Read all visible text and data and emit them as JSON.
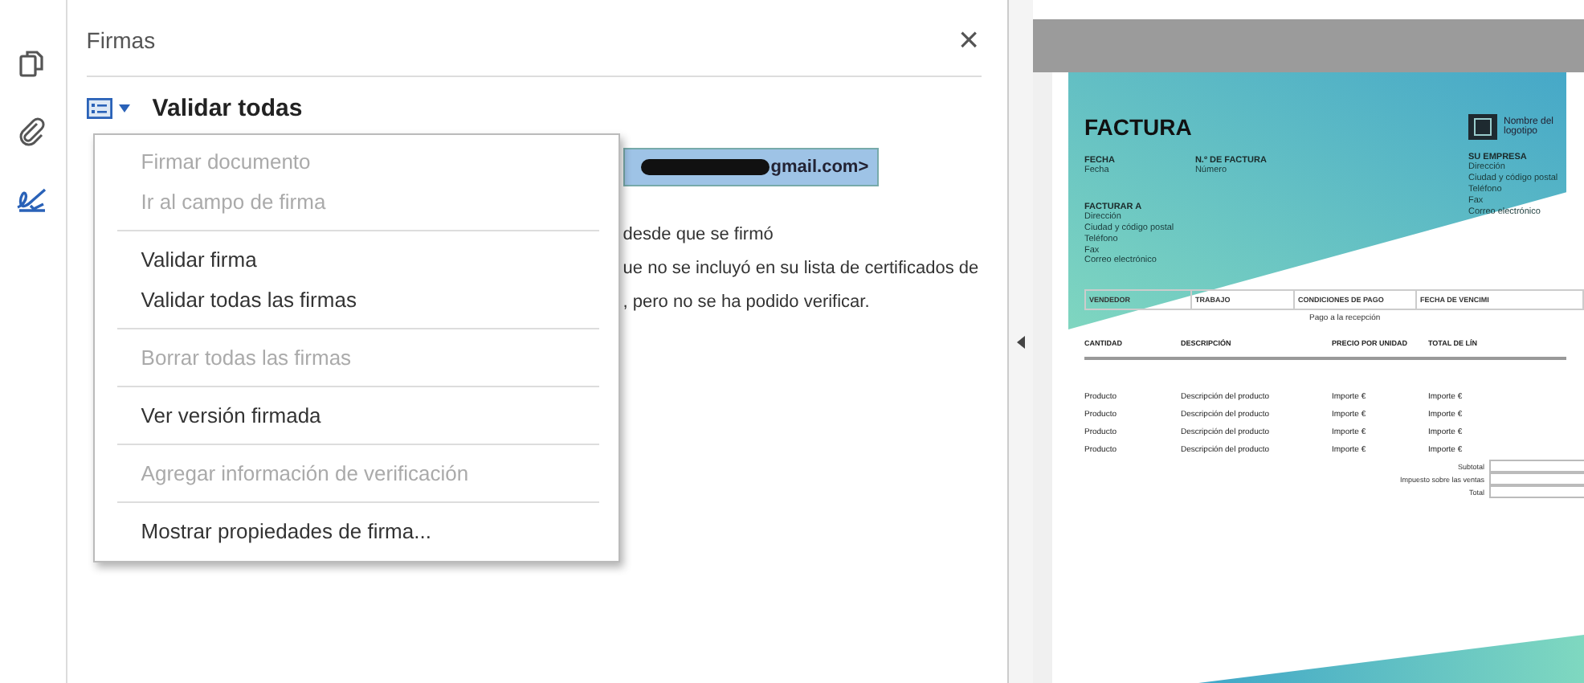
{
  "rail": [
    {
      "kind": "pages",
      "selected": false
    },
    {
      "kind": "attachments",
      "selected": false
    },
    {
      "kind": "signatures",
      "selected": true
    }
  ],
  "panel": {
    "title": "Firmas",
    "close": "×",
    "toolbar_label": "Validar todas",
    "signature_email": "gmail.com>",
    "details": [
      "desde que se firmó",
      "ue no se incluyó en su lista de certificados de",
      ", pero no se ha podido verificar."
    ]
  },
  "menu": [
    {
      "label": "Firmar documento",
      "disabled": true,
      "separator_before": false
    },
    {
      "label": "Ir al campo de firma",
      "disabled": true,
      "separator_before": false
    },
    {
      "label": "Validar firma",
      "disabled": false,
      "separator_before": true
    },
    {
      "label": "Validar todas las firmas",
      "disabled": false,
      "separator_before": false
    },
    {
      "label": "Borrar todas las firmas",
      "disabled": true,
      "separator_before": true
    },
    {
      "label": "Ver versión firmada",
      "disabled": false,
      "separator_before": true
    },
    {
      "label": "Agregar información de verificación",
      "disabled": true,
      "separator_before": true
    },
    {
      "label": "Mostrar propiedades de firma...",
      "disabled": false,
      "separator_before": true
    }
  ],
  "document": {
    "title": "FACTURA",
    "logo_text": "Nombre del logotipo",
    "date_label": "FECHA",
    "date_value": "Fecha",
    "number_label": "N.º DE FACTURA",
    "number_value": "Número",
    "company": {
      "heading": "SU EMPRESA",
      "lines": [
        "Dirección",
        "Ciudad y código postal",
        "Teléfono",
        "Fax",
        "Correo electrónico"
      ]
    },
    "bill_to": {
      "heading": "FACTURAR A",
      "lines": [
        "Dirección",
        "Ciudad y código postal",
        "Teléfono",
        "Fax",
        "Correo electrónico"
      ]
    },
    "terms_columns": [
      "VENDEDOR",
      "TRABAJO",
      "CONDICIONES DE PAGO",
      "FECHA DE VENCIMI"
    ],
    "terms_value": "Pago a la recepción",
    "item_columns": [
      "CANTIDAD",
      "DESCRIPCIÓN",
      "PRECIO POR UNIDAD",
      "TOTAL DE LÍN"
    ],
    "items": [
      {
        "quantity": "Producto",
        "description": "Descripción del producto",
        "unit_price": "Importe €",
        "total": "Importe €"
      },
      {
        "quantity": "Producto",
        "description": "Descripción del producto",
        "unit_price": "Importe €",
        "total": "Importe €"
      },
      {
        "quantity": "Producto",
        "description": "Descripción del producto",
        "unit_price": "Importe €",
        "total": "Importe €"
      },
      {
        "quantity": "Producto",
        "description": "Descripción del producto",
        "unit_price": "Importe €",
        "total": "Importe €"
      }
    ],
    "totals": [
      "Subtotal",
      "Impuesto sobre las ventas",
      "Total"
    ]
  }
}
